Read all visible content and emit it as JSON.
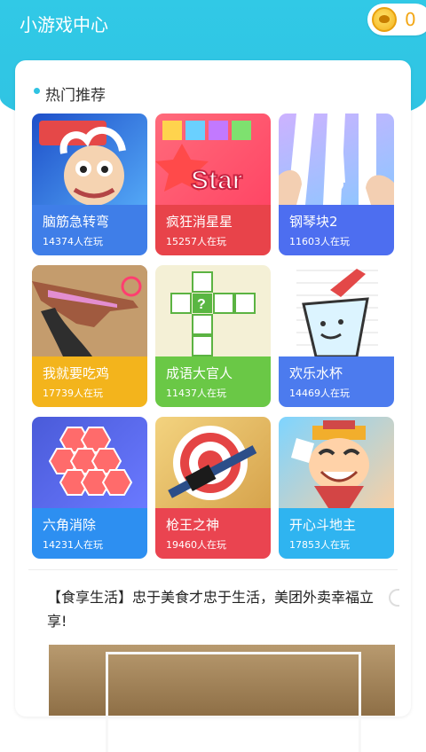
{
  "header": {
    "title": "小游戏中心",
    "coins": "0",
    "coin_icon": "paw-coin-icon"
  },
  "section": {
    "title": "热门推荐",
    "games": [
      {
        "name": "脑筋急转弯",
        "players": "14374人在玩",
        "color": "#3f7ee8"
      },
      {
        "name": "疯狂消星星",
        "players": "15257人在玩",
        "color": "#e8434a"
      },
      {
        "name": "钢琴块2",
        "players": "11603人在玩",
        "color": "#4d6ef0"
      },
      {
        "name": "我就要吃鸡",
        "players": "17739人在玩",
        "color": "#f3b41c"
      },
      {
        "name": "成语大官人",
        "players": "11437人在玩",
        "color": "#6ac846"
      },
      {
        "name": "欢乐水杯",
        "players": "14469人在玩",
        "color": "#4c7bee"
      },
      {
        "name": "六角消除",
        "players": "14231人在玩",
        "color": "#2d8ff1"
      },
      {
        "name": "枪王之神",
        "players": "19460人在玩",
        "color": "#ea4450"
      },
      {
        "name": "开心斗地主",
        "players": "17853人在玩",
        "color": "#2fb4f0"
      }
    ]
  },
  "article": {
    "title": "【食享生活】忠于美食才忠于生活，美团外卖幸福立享!"
  }
}
